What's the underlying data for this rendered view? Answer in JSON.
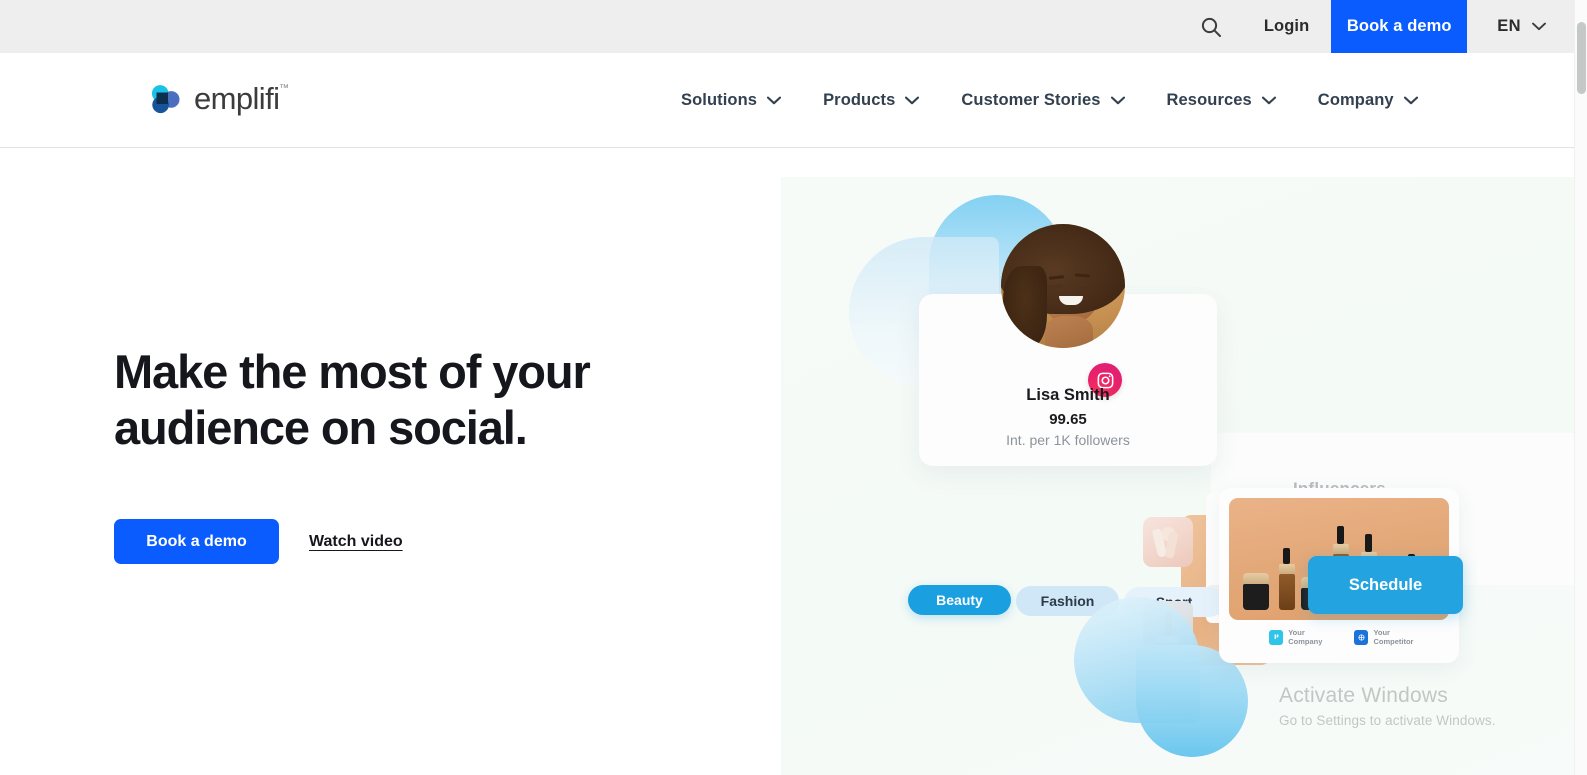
{
  "utility_bar": {
    "search_icon": "search-icon",
    "login_label": "Login",
    "demo_label": "Book a demo",
    "language_label": "EN",
    "language_chevron": "chevron-down-icon",
    "background_color": "#eeeeee",
    "accent_color": "#0a5cff"
  },
  "header": {
    "logo_text": "emplifi",
    "logo_tm": "™",
    "logo_colors": {
      "cyan": "#19c3e6",
      "blue": "#4a6fc0",
      "navy": "#0d2f4f"
    },
    "nav_items": [
      {
        "label": "Solutions",
        "chevron": "chevron-down-icon"
      },
      {
        "label": "Products",
        "chevron": "chevron-down-icon"
      },
      {
        "label": "Customer Stories",
        "chevron": "chevron-down-icon"
      },
      {
        "label": "Resources",
        "chevron": "chevron-down-icon"
      },
      {
        "label": "Company",
        "chevron": "chevron-down-icon"
      }
    ]
  },
  "hero": {
    "heading_line1": "Make the most of your",
    "heading_line2": "audience on social.",
    "primary_button": "Book a demo",
    "secondary_link": "Watch video",
    "background_color": "#f6fbf7"
  },
  "art": {
    "profile": {
      "name": "Lisa Smith",
      "score": "99.65",
      "score_caption": "Int. per 1K followers",
      "network_badge": "instagram-icon",
      "tags": [
        {
          "label": "Beauty",
          "active": true,
          "color": "#1a9fe0"
        },
        {
          "label": "Fashion",
          "active": false,
          "color": "#cfe7f7"
        },
        {
          "label": "Sport",
          "active": false,
          "color": "#e6f2fb"
        }
      ]
    },
    "influencers_label": "Influencers",
    "schedule_button": "Schedule",
    "legend": [
      {
        "label": "Your Company",
        "color": "#2ec5e8"
      },
      {
        "label": "Your Competitor",
        "color": "#1a73d8"
      }
    ]
  },
  "watermark": {
    "title": "Activate Windows",
    "subtitle": "Go to Settings to activate Windows."
  }
}
